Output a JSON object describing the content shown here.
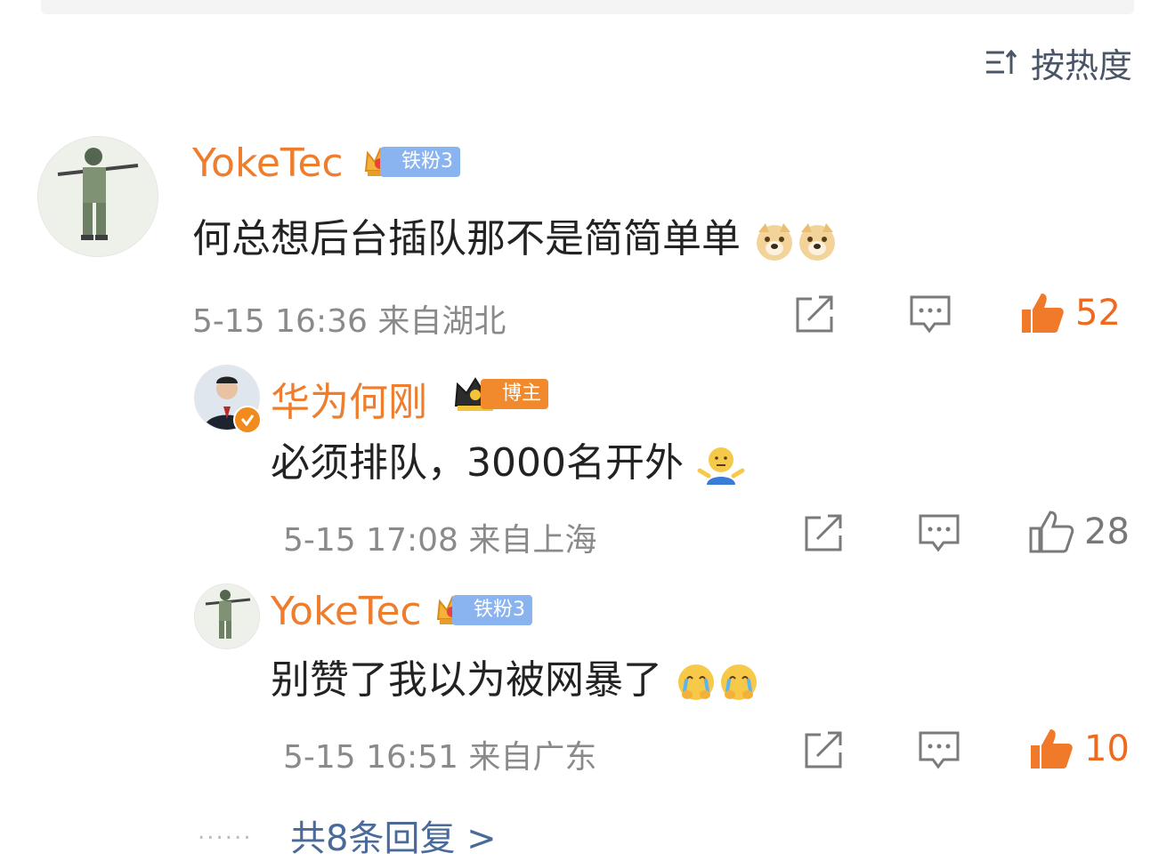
{
  "sort": {
    "label": "按热度",
    "icon": "sort-icon"
  },
  "comment": {
    "username": "YokeTec",
    "fan_badge": "铁粉3",
    "text": "何总想后台插队那不是简简单单",
    "emojis": [
      "doge-emoji",
      "doge-emoji"
    ],
    "date": "5-15 16:36 来自湖北",
    "like_count": "52",
    "liked": true
  },
  "replies": [
    {
      "username": "华为何刚",
      "badge": "博主",
      "verified": true,
      "text": "必须排队，3000名开外",
      "emojis": [
        "shrug-emoji"
      ],
      "date": "5-15 17:08 来自上海",
      "like_count": "28",
      "liked": false
    },
    {
      "username": "YokeTec",
      "badge": "铁粉3",
      "verified": false,
      "text": "别赞了我以为被网暴了",
      "emojis": [
        "crying-emoji",
        "crying-emoji"
      ],
      "date": "5-15 16:51 来自广东",
      "like_count": "10",
      "liked": true
    }
  ],
  "more_replies": {
    "dots": "......",
    "label": "共8条回复 >"
  },
  "colors": {
    "username": "#ef7d2e",
    "like_active": "#ef6a1f",
    "link": "#4a6a9a",
    "badge_fan": "#8ab4f0",
    "badge_blogger": "#f08a2c"
  }
}
